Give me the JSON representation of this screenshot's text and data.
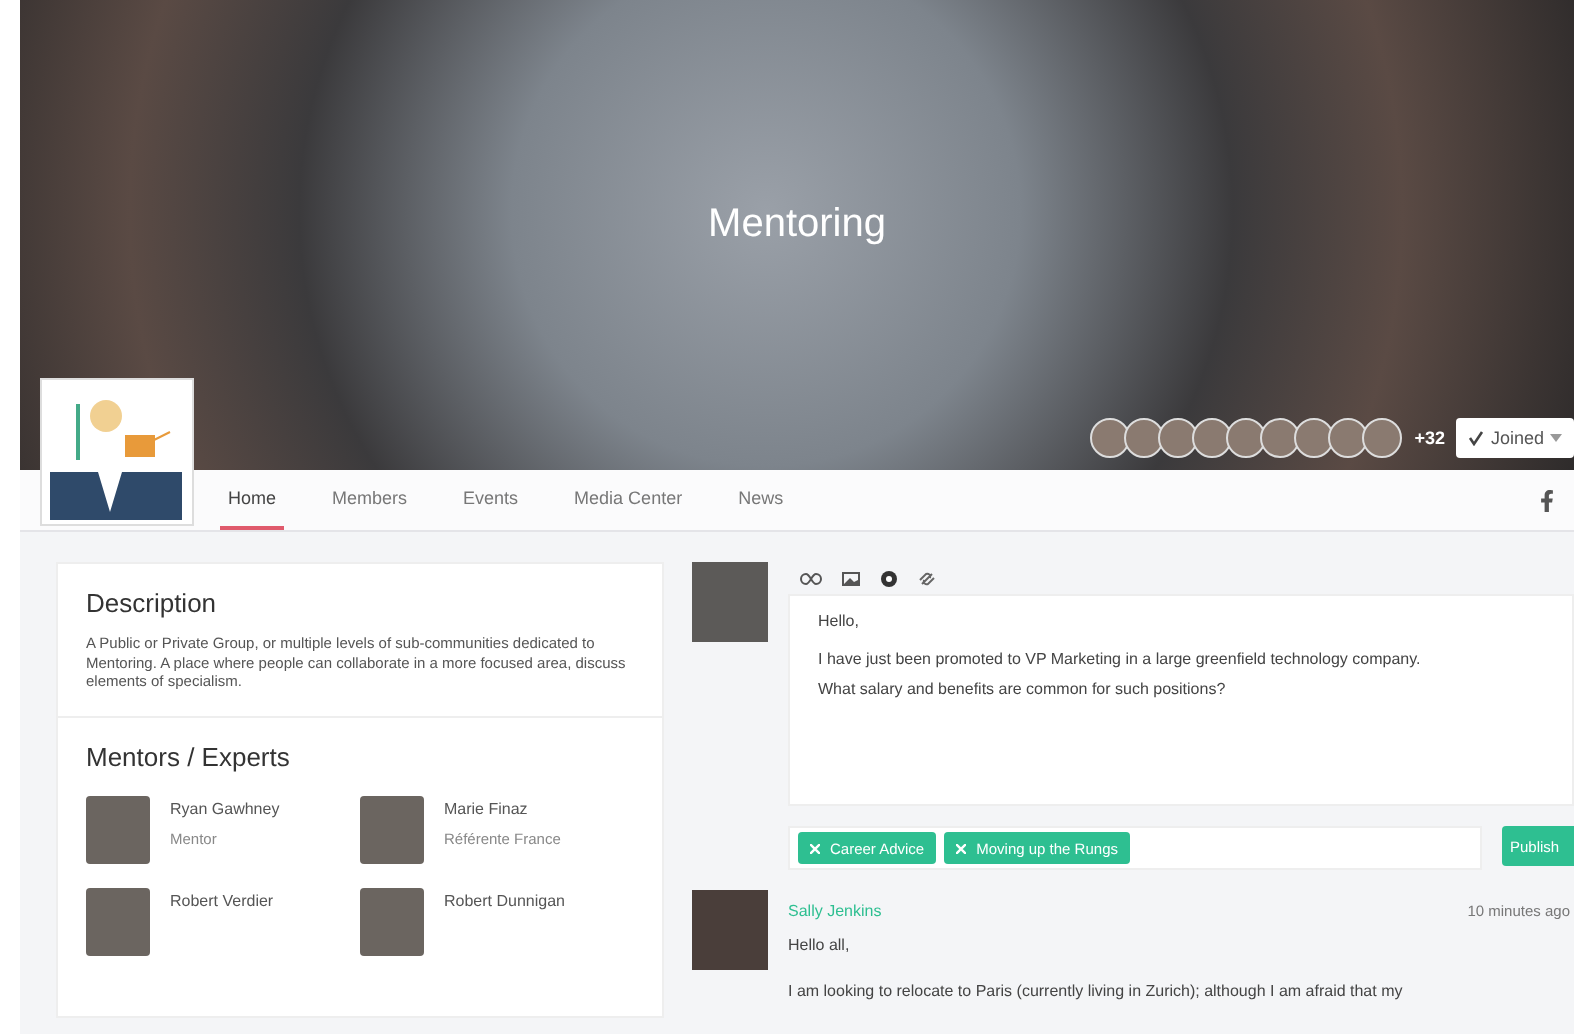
{
  "cover": {
    "title": "Mentoring",
    "member_count": "+32",
    "join_button": "Joined"
  },
  "nav": {
    "tabs": [
      {
        "label": "Home",
        "selected": true
      },
      {
        "label": "Members",
        "selected": false
      },
      {
        "label": "Events",
        "selected": false
      },
      {
        "label": "Media Center",
        "selected": false
      },
      {
        "label": "News",
        "selected": false
      }
    ]
  },
  "description": {
    "title": "Description",
    "text": "A Public or Private Group, or multiple levels of sub-communities dedicated to Mentoring. A place where people can collaborate in a more focused area, discuss elements of specialism."
  },
  "mentors": {
    "title": "Mentors / Experts",
    "people": [
      {
        "name": "Ryan Gawhney",
        "role": "Mentor"
      },
      {
        "name": "Marie Finaz",
        "role": "Référente France"
      },
      {
        "name": "Robert Verdier"
      },
      {
        "name": "Robert Dunnigan"
      }
    ]
  },
  "composer": {
    "lines": [
      "Hello,",
      "I have just been promoted to VP Marketing in a large greenfield technology company.",
      "What salary and benefits are common for such positions?"
    ],
    "tags": [
      "Career Advice",
      "Moving up the Rungs"
    ],
    "publish_button": "Publish"
  },
  "post": {
    "author": "Sally Jenkins",
    "time": "10 minutes ago",
    "lines": [
      "Hello all,",
      "I am looking to relocate to Paris (currently living in Zurich); although I am afraid that my"
    ]
  }
}
